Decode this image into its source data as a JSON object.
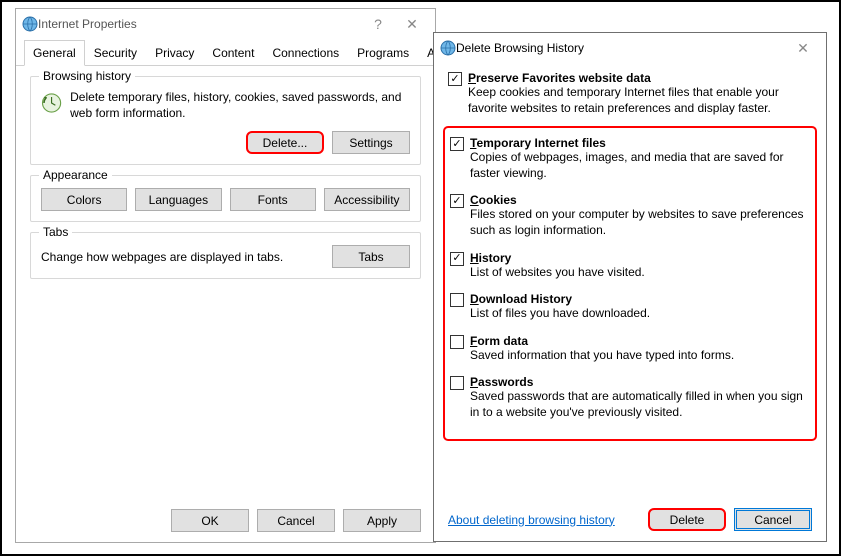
{
  "win1": {
    "title": "Internet Properties",
    "tabs": [
      "General",
      "Security",
      "Privacy",
      "Content",
      "Connections",
      "Programs",
      "Advanced"
    ],
    "browsing_history": {
      "legend": "Browsing history",
      "text": "Delete temporary files, history, cookies, saved passwords, and web form information.",
      "delete_btn": "Delete...",
      "settings_btn": "Settings"
    },
    "appearance": {
      "legend": "Appearance",
      "buttons": [
        "Colors",
        "Languages",
        "Fonts",
        "Accessibility"
      ]
    },
    "tabs_section": {
      "legend": "Tabs",
      "text": "Change how webpages are displayed in tabs.",
      "btn": "Tabs"
    },
    "footer": {
      "ok": "OK",
      "cancel": "Cancel",
      "apply": "Apply"
    }
  },
  "win2": {
    "title": "Delete Browsing History",
    "preserve": {
      "checked": true,
      "title_pre": "P",
      "title_rest": "reserve Favorites website data",
      "desc": "Keep cookies and temporary Internet files that enable your favorite websites to retain preferences and display faster."
    },
    "items": [
      {
        "checked": true,
        "u": "T",
        "rest": "emporary Internet files",
        "desc": "Copies of webpages, images, and media that are saved for faster viewing."
      },
      {
        "checked": true,
        "u": "C",
        "rest": "ookies",
        "desc": "Files stored on your computer by websites to save preferences such as login information."
      },
      {
        "checked": true,
        "u": "H",
        "rest": "istory",
        "desc": "List of websites you have visited."
      },
      {
        "checked": false,
        "u": "D",
        "rest": "ownload History",
        "desc": "List of files you have downloaded."
      },
      {
        "checked": false,
        "u": "F",
        "rest": "orm data",
        "desc": "Saved information that you have typed into forms."
      },
      {
        "checked": false,
        "u": "P",
        "rest": "asswords",
        "desc": "Saved passwords that are automatically filled in when you sign in to a website you've previously visited."
      }
    ],
    "about_link": "About deleting browsing history",
    "delete_btn": "Delete",
    "cancel_btn": "Cancel"
  }
}
